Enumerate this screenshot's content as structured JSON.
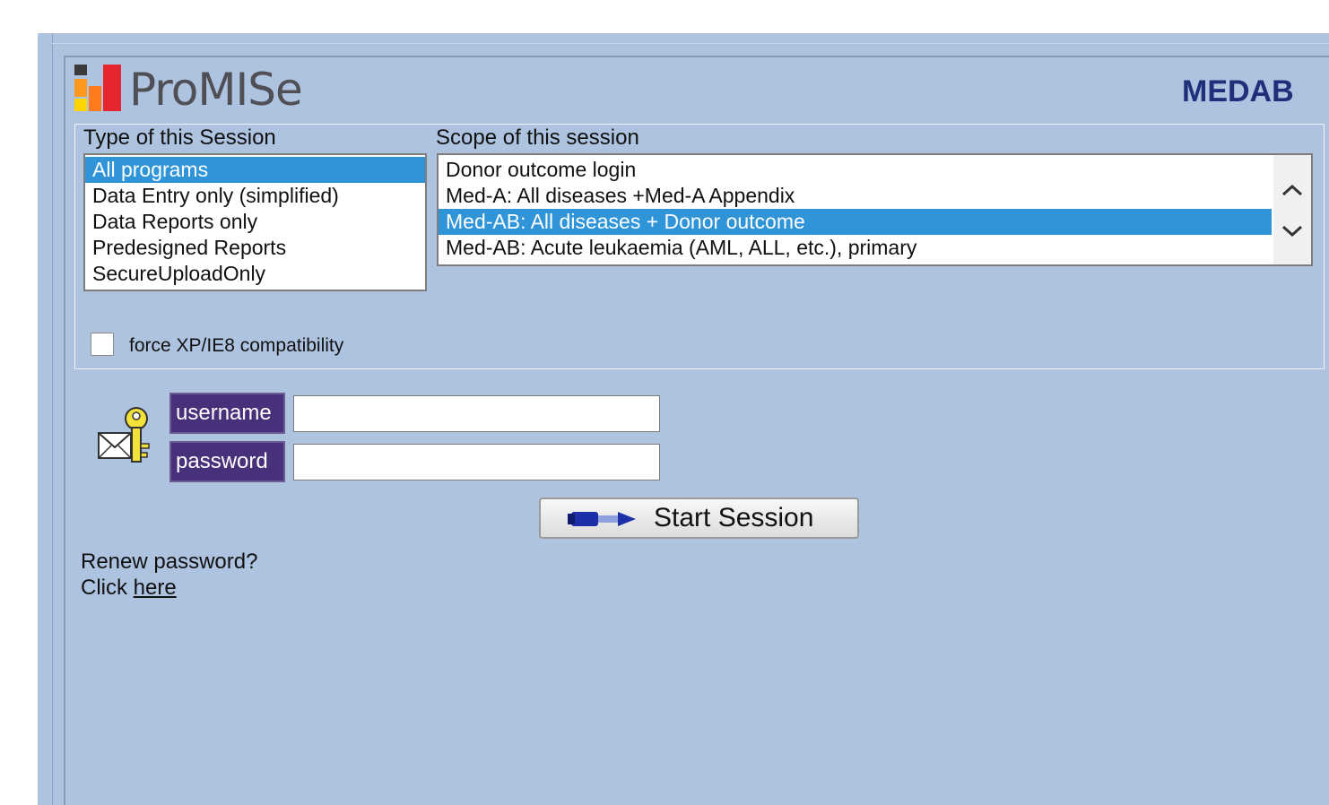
{
  "app": {
    "brand": "ProMISe",
    "org": "MEDAB"
  },
  "session_type": {
    "label": "Type of this Session",
    "options": [
      "All programs",
      "Data Entry only (simplified)",
      "Data Reports only",
      "Predesigned Reports",
      "SecureUploadOnly"
    ],
    "selected": "All programs"
  },
  "session_scope": {
    "label": "Scope of this session",
    "options": [
      "Donor outcome login",
      "Med-A: All diseases +Med-A Appendix",
      "Med-AB: All diseases + Donor outcome",
      "Med-AB: Acute leukaemia (AML, ALL, etc.), primary"
    ],
    "selected": "Med-AB: All diseases + Donor outcome"
  },
  "compat": {
    "label": "force XP/IE8 compatibility",
    "checked": false
  },
  "login": {
    "username_label": "username",
    "password_label": "password",
    "username_value": "",
    "password_value": ""
  },
  "start_button": {
    "label": "Start Session"
  },
  "renew": {
    "question": "Renew password?",
    "click_text": "Click",
    "link_text": "here"
  },
  "icons": [
    "promise-logo-icon",
    "key-envelope-icon",
    "pencil-arrow-icon",
    "chevron-up-icon",
    "chevron-down-icon"
  ],
  "colors": {
    "background": "#adc3df",
    "selection": "#2f94d8",
    "field_label_bg": "#48307a",
    "org_text": "#1f2f7a"
  }
}
